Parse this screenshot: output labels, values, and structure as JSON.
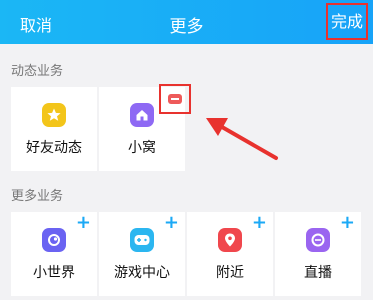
{
  "header": {
    "cancel_label": "取消",
    "title": "更多",
    "done_label": "完成"
  },
  "dynamic_section": {
    "label": "动态业务",
    "items": [
      {
        "label": "好友动态",
        "icon": "star-icon",
        "color": "#f3c51a"
      },
      {
        "label": "小窝",
        "icon": "house-icon",
        "color": "#8e69f4"
      }
    ]
  },
  "more_section": {
    "label": "更多业务",
    "items": [
      {
        "label": "小世界",
        "icon": "planet-icon",
        "color": "#6a63f2"
      },
      {
        "label": "游戏中心",
        "icon": "gamepad-icon",
        "color": "#2bb6f0"
      },
      {
        "label": "附近",
        "icon": "location-pin-icon",
        "color": "#f0474d"
      },
      {
        "label": "直播",
        "icon": "live-icon",
        "color": "#9a65f0"
      }
    ]
  },
  "colors": {
    "header_bg": "#17a3f8",
    "highlight_red": "#e8322e",
    "accent_blue": "#1ba9f6"
  }
}
